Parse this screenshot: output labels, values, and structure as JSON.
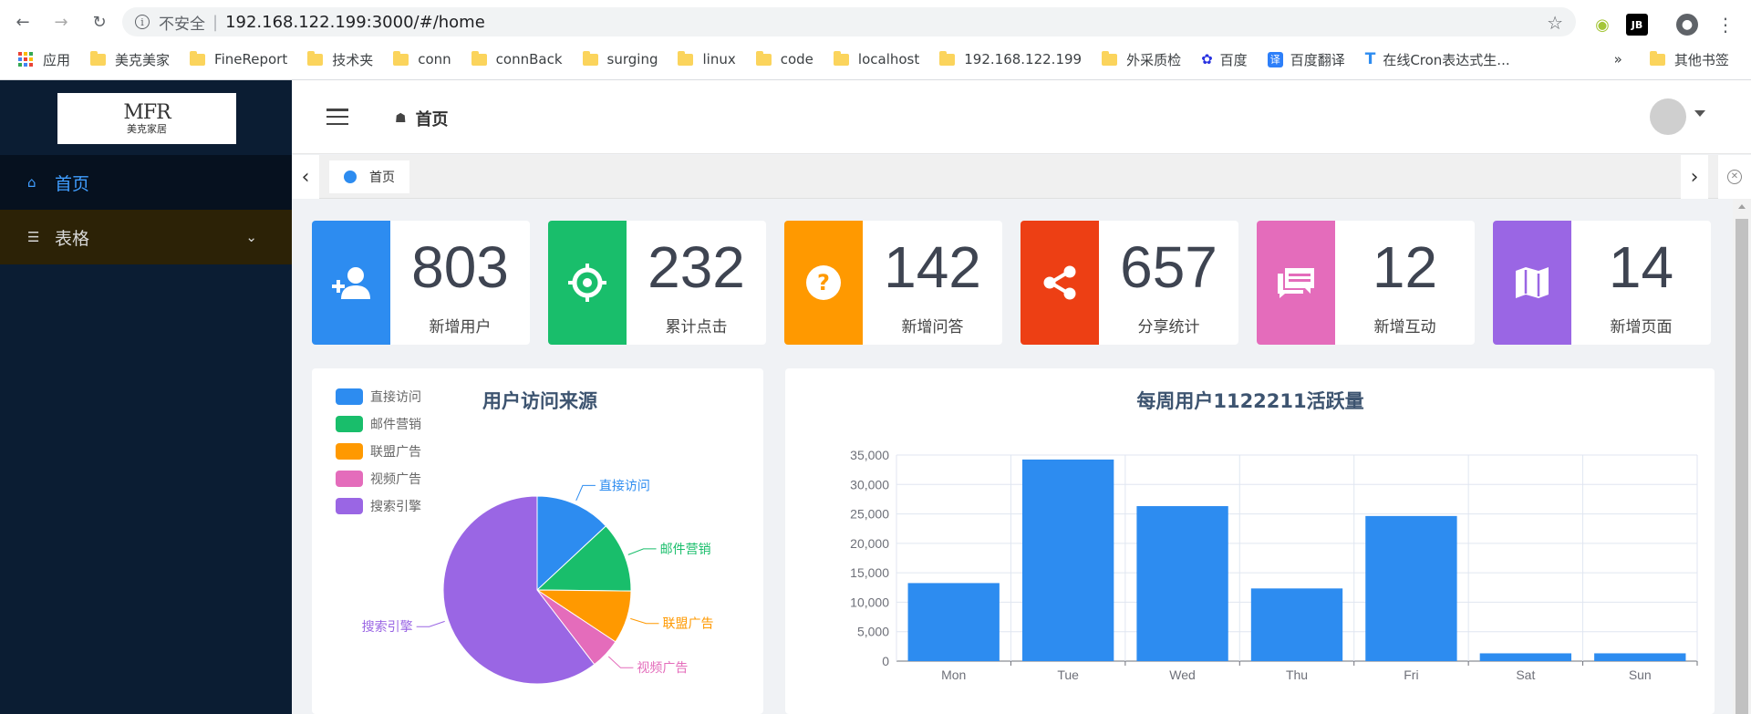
{
  "browser": {
    "insecure_label": "不安全",
    "url": "192.168.122.199:3000/#/home",
    "bookmarks": [
      "应用",
      "美克美家",
      "FineReport",
      "技术夹",
      "conn",
      "connBack",
      "surging",
      "linux",
      "code",
      "localhost",
      "192.168.122.199",
      "外采质检",
      "百度",
      "百度翻译",
      "在线Cron表达式生...",
      "»",
      "其他书签"
    ]
  },
  "sidebar": {
    "logo_main": "MFR",
    "logo_sub": "美克家居",
    "items": [
      {
        "label": "首页",
        "icon": "home-icon",
        "active": true
      },
      {
        "label": "表格",
        "icon": "layers-icon",
        "active": false
      }
    ]
  },
  "header": {
    "breadcrumb": "首页"
  },
  "tags": {
    "items": [
      {
        "label": "首页"
      }
    ]
  },
  "stats": [
    {
      "value": "803",
      "label": "新增用户",
      "color": "#2d8cf0",
      "icon": "add-user-icon"
    },
    {
      "value": "232",
      "label": "累计点击",
      "color": "#19be6b",
      "icon": "target-icon"
    },
    {
      "value": "142",
      "label": "新增问答",
      "color": "#ff9900",
      "icon": "question-icon"
    },
    {
      "value": "657",
      "label": "分享统计",
      "color": "#ed3f14",
      "icon": "share-icon"
    },
    {
      "value": "12",
      "label": "新增互动",
      "color": "#e46cbb",
      "icon": "chat-icon"
    },
    {
      "value": "14",
      "label": "新增页面",
      "color": "#9a66e4",
      "icon": "map-icon"
    }
  ],
  "chart_data": [
    {
      "type": "pie",
      "title": "用户访问来源",
      "legend_position": "top-left",
      "categories": [
        "直接访问",
        "邮件营销",
        "联盟广告",
        "视频广告",
        "搜索引擎"
      ],
      "values": [
        335,
        310,
        234,
        135,
        1548
      ],
      "colors": [
        "#2d8cf0",
        "#19be6b",
        "#ff9900",
        "#e46cbb",
        "#9a66e4"
      ]
    },
    {
      "type": "bar",
      "title": "每周用户1122211活跃量",
      "categories": [
        "Mon",
        "Tue",
        "Wed",
        "Thu",
        "Fri",
        "Sat",
        "Sun"
      ],
      "values": [
        13253,
        34235,
        26321,
        12340,
        24643,
        1322,
        1324
      ],
      "ylim": [
        0,
        35000
      ],
      "yticks": [
        "0",
        "5,000",
        "10,000",
        "15,000",
        "20,000",
        "25,000",
        "30,000",
        "35,000"
      ],
      "grid": true,
      "color": "#2d8cf0"
    }
  ]
}
